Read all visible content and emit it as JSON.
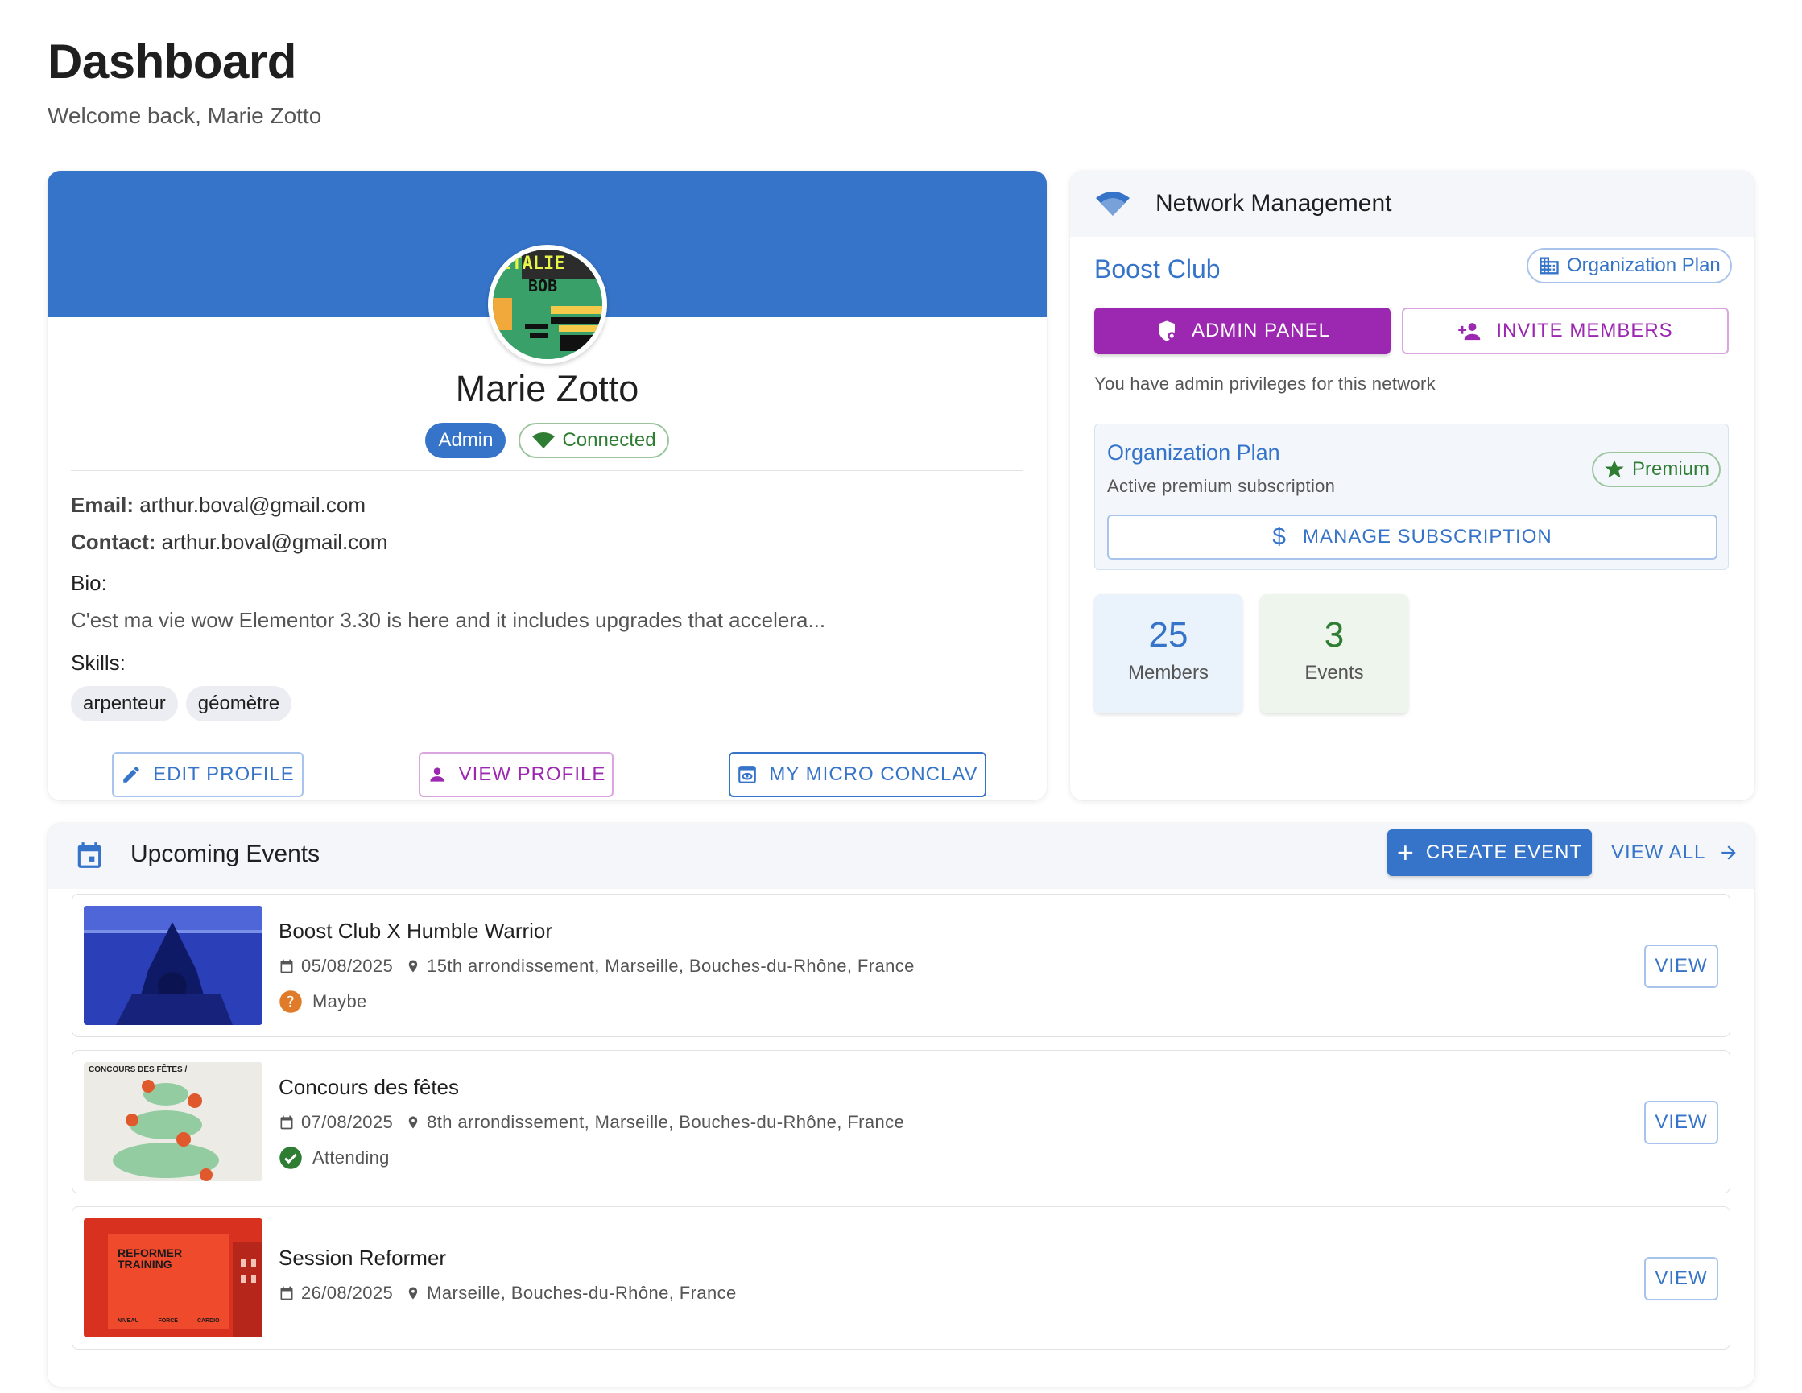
{
  "page": {
    "title": "Dashboard",
    "subtitle": "Welcome back, Marie Zotto"
  },
  "profile": {
    "name": "Marie Zotto",
    "role_badge": "Admin",
    "status_badge": "Connected",
    "email_label": "Email:",
    "email": "arthur.boval@gmail.com",
    "contact_label": "Contact:",
    "contact": "arthur.boval@gmail.com",
    "bio_label": "Bio:",
    "bio": "C'est ma vie wow Elementor 3.30 is here and it includes upgrades that accelera...",
    "skills_label": "Skills:",
    "skills": [
      "arpenteur",
      "géomètre"
    ],
    "buttons": {
      "edit": "EDIT PROFILE",
      "view": "VIEW PROFILE",
      "micro": "MY MICRO CONCLAV"
    },
    "avatar_text": [
      "ITALIE",
      "BOB"
    ]
  },
  "network": {
    "header": "Network Management",
    "club_name": "Boost Club",
    "plan_chip": "Organization Plan",
    "admin_button": "ADMIN PANEL",
    "invite_button": "INVITE MEMBERS",
    "admin_note": "You have admin privileges for this network",
    "plan": {
      "title": "Organization Plan",
      "subtitle": "Active premium subscription",
      "badge": "Premium",
      "manage_button": "MANAGE SUBSCRIPTION"
    },
    "stats": [
      {
        "value": "25",
        "label": "Members",
        "color": "#3674c9"
      },
      {
        "value": "3",
        "label": "Events",
        "color": "#2e7d32"
      }
    ]
  },
  "events": {
    "header": "Upcoming Events",
    "create_button": "CREATE EVENT",
    "view_all_button": "VIEW ALL",
    "view_label": "VIEW",
    "items": [
      {
        "title": "Boost Club X Humble Warrior",
        "date": "05/08/2025",
        "location": "15th arrondissement, Marseille, Bouches-du-Rhône, France",
        "status": "Maybe"
      },
      {
        "title": "Concours des fêtes",
        "date": "07/08/2025",
        "location": "8th arrondissement, Marseille, Bouches-du-Rhône, France",
        "status": "Attending",
        "thumb_text": "CONCOURS DES FÊTES /"
      },
      {
        "title": "Session Reformer",
        "date": "26/08/2025",
        "location": "Marseille, Bouches-du-Rhône, France",
        "thumb_text": "REFORMER TRAINING",
        "thumb_footer": [
          "NIVEAU",
          "FORCE",
          "CARDIO"
        ]
      }
    ]
  },
  "colors": {
    "primary": "#3674c9",
    "purple": "#9c27b0",
    "green": "#2e7d32",
    "maybe": "#e07b2a"
  }
}
